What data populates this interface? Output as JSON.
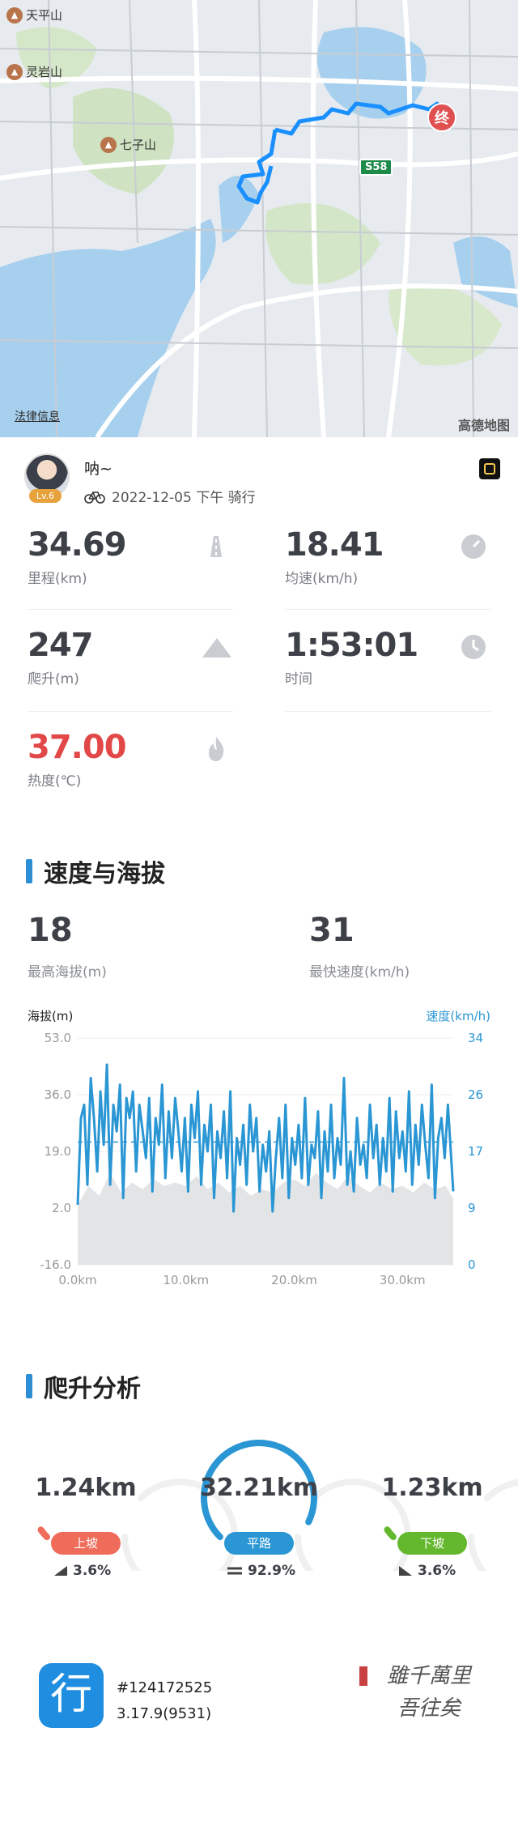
{
  "map": {
    "pois": [
      {
        "name": "天平山"
      },
      {
        "name": "灵岩山"
      },
      {
        "name": "七子山"
      }
    ],
    "road_badge": "S58",
    "end_marker": "终",
    "legal": "法律信息",
    "brand": "高德地图"
  },
  "user": {
    "name": "呐~",
    "level": "Lv.6",
    "datetime": "2022-12-05 下午 骑行"
  },
  "stats": {
    "distance": {
      "value": "34.69",
      "label": "里程(km)",
      "icon": "road-icon"
    },
    "avg_speed": {
      "value": "18.41",
      "label": "均速(km/h)",
      "icon": "gauge-icon"
    },
    "climb": {
      "value": "247",
      "label": "爬升(m)",
      "icon": "mountain-icon"
    },
    "time": {
      "value": "1:53:01",
      "label": "时间",
      "icon": "clock-icon"
    },
    "calories": {
      "value": "37.00",
      "label": "热度(℃)",
      "icon": "flame-icon",
      "color": "#e34848"
    }
  },
  "speed_elev": {
    "title": "速度与海拔",
    "max_elev": {
      "value": "18",
      "label": "最高海拔(m)"
    },
    "max_speed": {
      "value": "31",
      "label": "最快速度(km/h)"
    }
  },
  "chart_data": {
    "type": "line",
    "left_axis_label": "海拔(m)",
    "right_axis_label": "速度(km/h)",
    "left_ticks": [
      "53.0",
      "36.0",
      "19.0",
      "2.0",
      "-16.0"
    ],
    "right_ticks": [
      "34",
      "26",
      "17",
      "9",
      "0"
    ],
    "x_ticks": [
      "0.0km",
      "10.0km",
      "20.0km",
      "30.0km"
    ],
    "ylim_elev": [
      -16,
      53
    ],
    "ylim_speed": [
      0,
      34
    ],
    "xlim": [
      0,
      34.69
    ],
    "avg_speed_line": 18.41,
    "colors": {
      "speed": "#2a96d4",
      "elev": "#e3e4e6",
      "axis_left": "#999999",
      "axis_right": "#2a96d4"
    },
    "series": [
      {
        "name": "速度",
        "axis": "right",
        "x": [
          0,
          0.3,
          0.6,
          0.9,
          1.2,
          1.5,
          1.8,
          2.1,
          2.4,
          2.7,
          3.0,
          3.3,
          3.6,
          3.9,
          4.2,
          4.5,
          4.8,
          5.1,
          5.4,
          5.7,
          6.0,
          6.3,
          6.6,
          6.9,
          7.2,
          7.5,
          7.8,
          8.1,
          8.4,
          8.7,
          9.0,
          9.3,
          9.6,
          9.9,
          10.2,
          10.5,
          10.8,
          11.1,
          11.4,
          11.7,
          12.0,
          12.3,
          12.6,
          12.9,
          13.2,
          13.5,
          13.8,
          14.1,
          14.4,
          14.7,
          15.0,
          15.3,
          15.6,
          15.9,
          16.2,
          16.5,
          16.8,
          17.1,
          17.4,
          17.7,
          18.0,
          18.3,
          18.6,
          18.9,
          19.2,
          19.5,
          19.8,
          20.1,
          20.4,
          20.7,
          21.0,
          21.3,
          21.6,
          21.9,
          22.2,
          22.5,
          22.8,
          23.1,
          23.4,
          23.7,
          24.0,
          24.3,
          24.6,
          24.9,
          25.2,
          25.5,
          25.8,
          26.1,
          26.4,
          26.7,
          27.0,
          27.3,
          27.6,
          27.9,
          28.2,
          28.5,
          28.8,
          29.1,
          29.4,
          29.7,
          30.0,
          30.3,
          30.6,
          30.9,
          31.2,
          31.5,
          31.8,
          32.1,
          32.4,
          32.7,
          33.0,
          33.3,
          33.6,
          33.9,
          34.2,
          34.69
        ],
        "values": [
          9,
          22,
          24,
          12,
          28,
          22,
          14,
          26,
          18,
          30,
          12,
          24,
          20,
          27,
          10,
          25,
          22,
          26,
          14,
          24,
          20,
          16,
          25,
          11,
          22,
          18,
          27,
          13,
          23,
          16,
          25,
          20,
          14,
          22,
          11,
          24,
          19,
          26,
          12,
          21,
          17,
          24,
          10,
          20,
          16,
          23,
          13,
          26,
          8,
          19,
          15,
          21,
          12,
          24,
          17,
          22,
          11,
          18,
          14,
          20,
          8,
          16,
          22,
          13,
          24,
          10,
          19,
          15,
          21,
          13,
          25,
          12,
          18,
          16,
          23,
          10,
          20,
          14,
          24,
          13,
          19,
          15,
          28,
          12,
          17,
          11,
          22,
          15,
          18,
          13,
          24,
          16,
          21,
          12,
          19,
          14,
          25,
          11,
          23,
          16,
          20,
          14,
          26,
          12,
          21,
          15,
          24,
          18,
          13,
          27,
          10,
          19,
          22,
          16,
          24,
          11
        ]
      },
      {
        "name": "海拔",
        "axis": "left",
        "x": [
          0,
          1,
          2,
          3,
          4,
          5,
          6,
          7,
          8,
          9,
          10,
          11,
          12,
          13,
          14,
          15,
          16,
          17,
          18,
          19,
          20,
          21,
          22,
          23,
          24,
          25,
          26,
          27,
          28,
          29,
          30,
          31,
          32,
          33,
          34,
          34.69
        ],
        "values": [
          2,
          8,
          5,
          12,
          6,
          9,
          7,
          10,
          8,
          9,
          8,
          11,
          7,
          9,
          6,
          8,
          5,
          7,
          6,
          9,
          10,
          8,
          12,
          9,
          7,
          11,
          8,
          6,
          9,
          7,
          8,
          6,
          9,
          7,
          8,
          4
        ]
      }
    ]
  },
  "climb": {
    "title": "爬升分析",
    "items": [
      {
        "value": "1.24km",
        "label": "上坡",
        "pct": "3.6%",
        "color": "#ef6b5a",
        "fraction": 0.036,
        "icon": "uphill-icon"
      },
      {
        "value": "32.21km",
        "label": "平路",
        "pct": "92.9%",
        "color": "#2a96d4",
        "fraction": 0.929,
        "icon": "flat-road-icon"
      },
      {
        "value": "1.23km",
        "label": "下坡",
        "pct": "3.6%",
        "color": "#64b82e",
        "fraction": 0.036,
        "icon": "downhill-icon"
      }
    ]
  },
  "footer": {
    "app_icon_glyph": "行",
    "id": "#124172525",
    "version": "3.17.9(9531)",
    "calligraphy_line1": "雖千萬里",
    "calligraphy_line2": "吾往矣"
  }
}
